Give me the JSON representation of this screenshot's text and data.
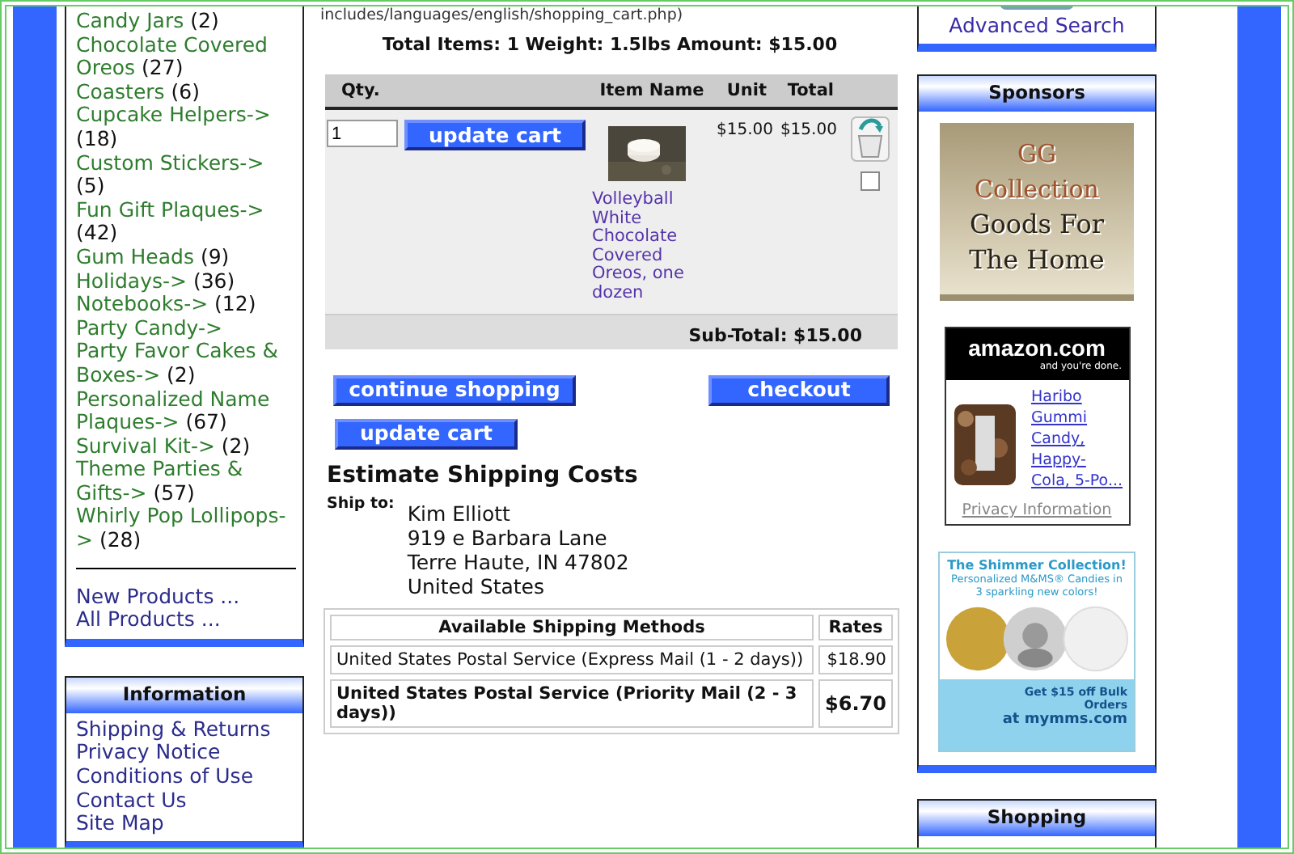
{
  "categories": [
    {
      "name": "Candy Jars",
      "count": "(2)"
    },
    {
      "name": "Chocolate Covered Oreos",
      "count": "(27)"
    },
    {
      "name": "Coasters",
      "count": "(6)"
    },
    {
      "name": "Cupcake Helpers->",
      "count": "(18)"
    },
    {
      "name": "Custom Stickers->",
      "count": "(5)"
    },
    {
      "name": "Fun Gift Plaques->",
      "count": "(42)"
    },
    {
      "name": "Gum Heads",
      "count": "(9)"
    },
    {
      "name": "Holidays->",
      "count": "(36)"
    },
    {
      "name": "Notebooks->",
      "count": "(12)"
    },
    {
      "name": "Party Candy->"
    },
    {
      "name": "Party Favor Cakes & Boxes->",
      "count": "(2)"
    },
    {
      "name": "Personalized Name Plaques->",
      "count": "(67)"
    },
    {
      "name": "Survival Kit->",
      "count": "(2)"
    },
    {
      "name": "Theme Parties & Gifts->",
      "count": "(57)"
    },
    {
      "name": "Whirly Pop Lollipops->",
      "count": "(28)"
    }
  ],
  "product_links": [
    "New Products ...",
    "All Products ..."
  ],
  "information": {
    "title": "Information",
    "links": [
      "Shipping & Returns",
      "Privacy Notice",
      "Conditions of Use",
      "Contact Us",
      "Site Map"
    ]
  },
  "path_text": "includes/languages/english/shopping_cart.php)",
  "totals": "Total Items: 1  Weight: 1.5lbs  Amount: $15.00",
  "cart": {
    "columns": [
      "Qty.",
      "Item Name",
      "Unit",
      "Total"
    ],
    "rows": [
      {
        "qty": "1",
        "update": "update cart",
        "name": "Volleyball White Chocolate Covered Oreos, one dozen",
        "unit": "$15.00",
        "total": "$15.00",
        "remove": false
      }
    ],
    "subtotal": "Sub-Total: $15.00"
  },
  "buttons": {
    "continue": "continue shopping",
    "checkout": "checkout",
    "update": "update cart"
  },
  "shipping": {
    "title": "Estimate Shipping Costs",
    "ship_to_label": "Ship to:",
    "address": [
      "Kim Elliott",
      "919 e Barbara Lane",
      "Terre Haute, IN 47802",
      "United States"
    ],
    "columns": [
      "Available Shipping Methods",
      "Rates"
    ],
    "methods": [
      {
        "name": "United States Postal Service (Express Mail (1 - 2 days))",
        "rate": "$18.90",
        "selected": false
      },
      {
        "name": "United States Postal Service (Priority Mail (2 - 3 days))",
        "rate": "$6.70",
        "selected": true
      }
    ]
  },
  "advanced_search": "Advanced Search",
  "sponsors": {
    "title": "Sponsors",
    "gg_banner": [
      "GG",
      "Collection",
      "Goods For",
      "The Home"
    ],
    "amazon": {
      "logo": "amazon.com",
      "tagline": "and you're done.",
      "product": "Haribo Gummi Candy, Happy-Cola, 5-Po...",
      "privacy": "Privacy Information"
    },
    "mms_banner": {
      "headline": "The Shimmer Collection!",
      "subline": "Personalized M&MS® Candies in 3 sparkling new colors!",
      "offer": "Get $15 off Bulk Orders",
      "site": "at mymms.com"
    }
  },
  "shopping_title": "Shopping"
}
